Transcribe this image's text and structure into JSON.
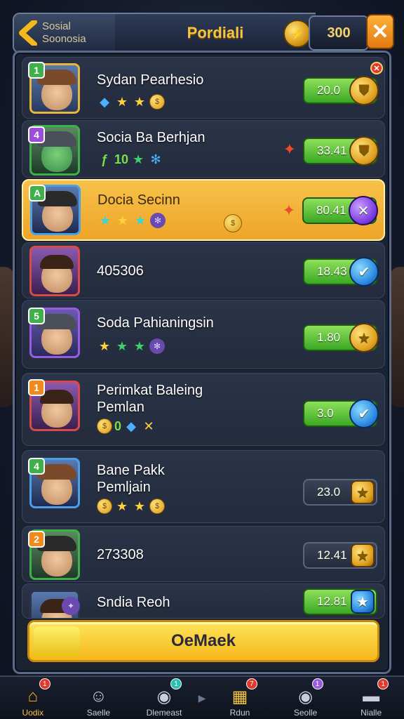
{
  "header": {
    "back_label_line1": "Sosial",
    "back_label_line2": "Soonosia",
    "title": "Pordiali",
    "coins": "300",
    "close_glyph": "✕"
  },
  "rows": [
    {
      "rank": "1",
      "name": "Sydan Pearhesio",
      "score": "20.0",
      "badge": "gold"
    },
    {
      "rank": "4",
      "name": "Socia Ba Berhjan",
      "score": "33.41",
      "badge": "gold",
      "icon_num": "10"
    },
    {
      "rank": "A",
      "name": "Docia Secinn",
      "score": "80.41",
      "badge": "purple"
    },
    {
      "rank": "",
      "name": "405306",
      "score": "18.43",
      "badge": "blue"
    },
    {
      "rank": "5",
      "name": "Soda Pahianingsin",
      "score": "1.80",
      "badge": "gold"
    },
    {
      "rank": "1",
      "name_line1": "Perimkat Baleing",
      "name_line2": "Pemlan",
      "score": "3.0",
      "badge": "blue",
      "icon_num": "0"
    },
    {
      "rank": "4",
      "name_line1": "Bane Pakk",
      "name_line2": "Pemljain",
      "score": "23.0",
      "badge": "sq-gold"
    },
    {
      "rank": "2",
      "name": "273308",
      "score": "12.41",
      "badge": "sq-gold"
    },
    {
      "rank": "",
      "name": "Sndia Reoh",
      "score": "12.81",
      "badge": "sq-blue"
    }
  ],
  "main_button": "OeMaek",
  "nav": [
    {
      "label": "Uodix",
      "icon": "home-icon",
      "badge": "1"
    },
    {
      "label": "Saelle",
      "icon": "person-icon",
      "badge": ""
    },
    {
      "label": "Dlemeast",
      "icon": "disc-icon",
      "badge": "1"
    },
    {
      "label": "Rdun",
      "icon": "box-icon",
      "badge": "7"
    },
    {
      "label": "Seolle",
      "icon": "disc-icon",
      "badge": "1"
    },
    {
      "label": "Nialle",
      "icon": "anvil-icon",
      "badge": "1"
    }
  ]
}
